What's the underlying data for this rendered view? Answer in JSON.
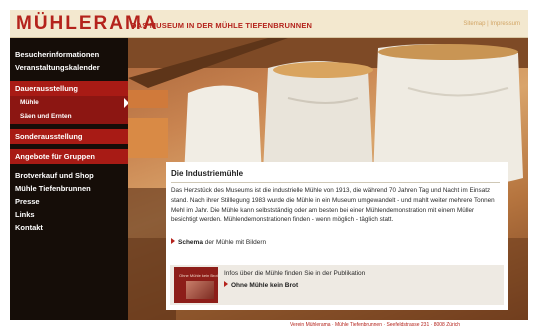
{
  "header": {
    "logo": "MÜHLERAMA",
    "tagline": "DAS MUSEUM IN DER MÜHLE TIEFENBRUNNEN",
    "links": [
      "Sitemap",
      "Impressum"
    ],
    "link_separator": "|"
  },
  "sidebar": {
    "items": [
      {
        "label": "Besucherinformationen"
      },
      {
        "label": "Veranstaltungskalender"
      },
      {
        "label": "Dauerausstellung"
      },
      {
        "label": "Mühle"
      },
      {
        "label": "Säen und Ernten"
      },
      {
        "label": "Sonderausstellung"
      },
      {
        "label": "Angebote für Gruppen"
      },
      {
        "label": "Brotverkauf und Shop"
      },
      {
        "label": "Mühle Tiefenbrunnen"
      },
      {
        "label": "Presse"
      },
      {
        "label": "Links"
      },
      {
        "label": "Kontakt"
      }
    ]
  },
  "content": {
    "title": "Die Industriemühle",
    "paragraph": "Das Herzstück des Museums ist die industrielle Mühle von 1913, die während 70 Jahren Tag und Nacht im Einsatz stand. Nach ihrer Stilllegung 1983 wurde die Mühle in ein Museum umgewandelt - und mahlt weiter mehrere Tonnen Mehl im Jahr. Die Mühle kann selbstständig oder am besten bei einer Mühlendemonstration mit einem Müller besichtigt werden. Mühlendemonstrationen finden - wenn möglich - täglich statt.",
    "schema_link": "Schema",
    "schema_rest": " der Mühle mit Bildern",
    "publication_text": "Infos über die Mühle finden Sie in der Publikation",
    "publication_link": "Ohne Mühle kein Brot",
    "book_cover_text": "Ohne Mühle kein Brot"
  },
  "footer": {
    "text": "Verein Mühlerama · Mühle Tiefenbrunnen · Seefeldstrasse 231 · 8008 Zürich"
  },
  "colors": {
    "brand_red": "#b4231c",
    "sidebar_bg": "#150d08",
    "header_bg": "#f3e8cf"
  }
}
